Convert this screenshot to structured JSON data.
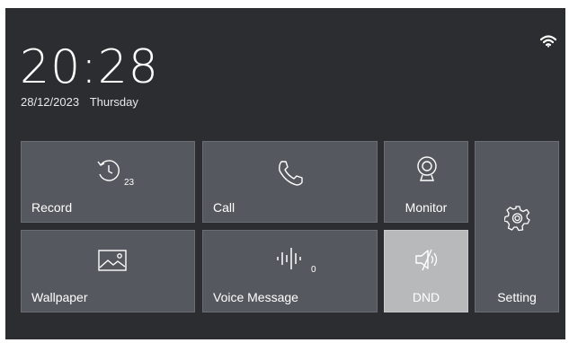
{
  "status": {
    "time": "20:28",
    "date": "28/12/2023",
    "weekday": "Thursday",
    "wifi_icon": "wifi-icon"
  },
  "tiles": {
    "record": {
      "label": "Record",
      "icon": "history-icon",
      "count": "23"
    },
    "call": {
      "label": "Call",
      "icon": "phone-icon"
    },
    "monitor": {
      "label": "Monitor",
      "icon": "camera-icon"
    },
    "setting": {
      "label": "Setting",
      "icon": "gear-icon"
    },
    "wallpaper": {
      "label": "Wallpaper",
      "icon": "image-icon"
    },
    "voice_message": {
      "label": "Voice Message",
      "icon": "soundwave-icon",
      "count": "0"
    },
    "dnd": {
      "label": "DND",
      "icon": "mute-icon",
      "active": true
    }
  },
  "colors": {
    "background": "#2b2d31",
    "tile": "#55585e",
    "tile_active": "#b8b9bb"
  }
}
